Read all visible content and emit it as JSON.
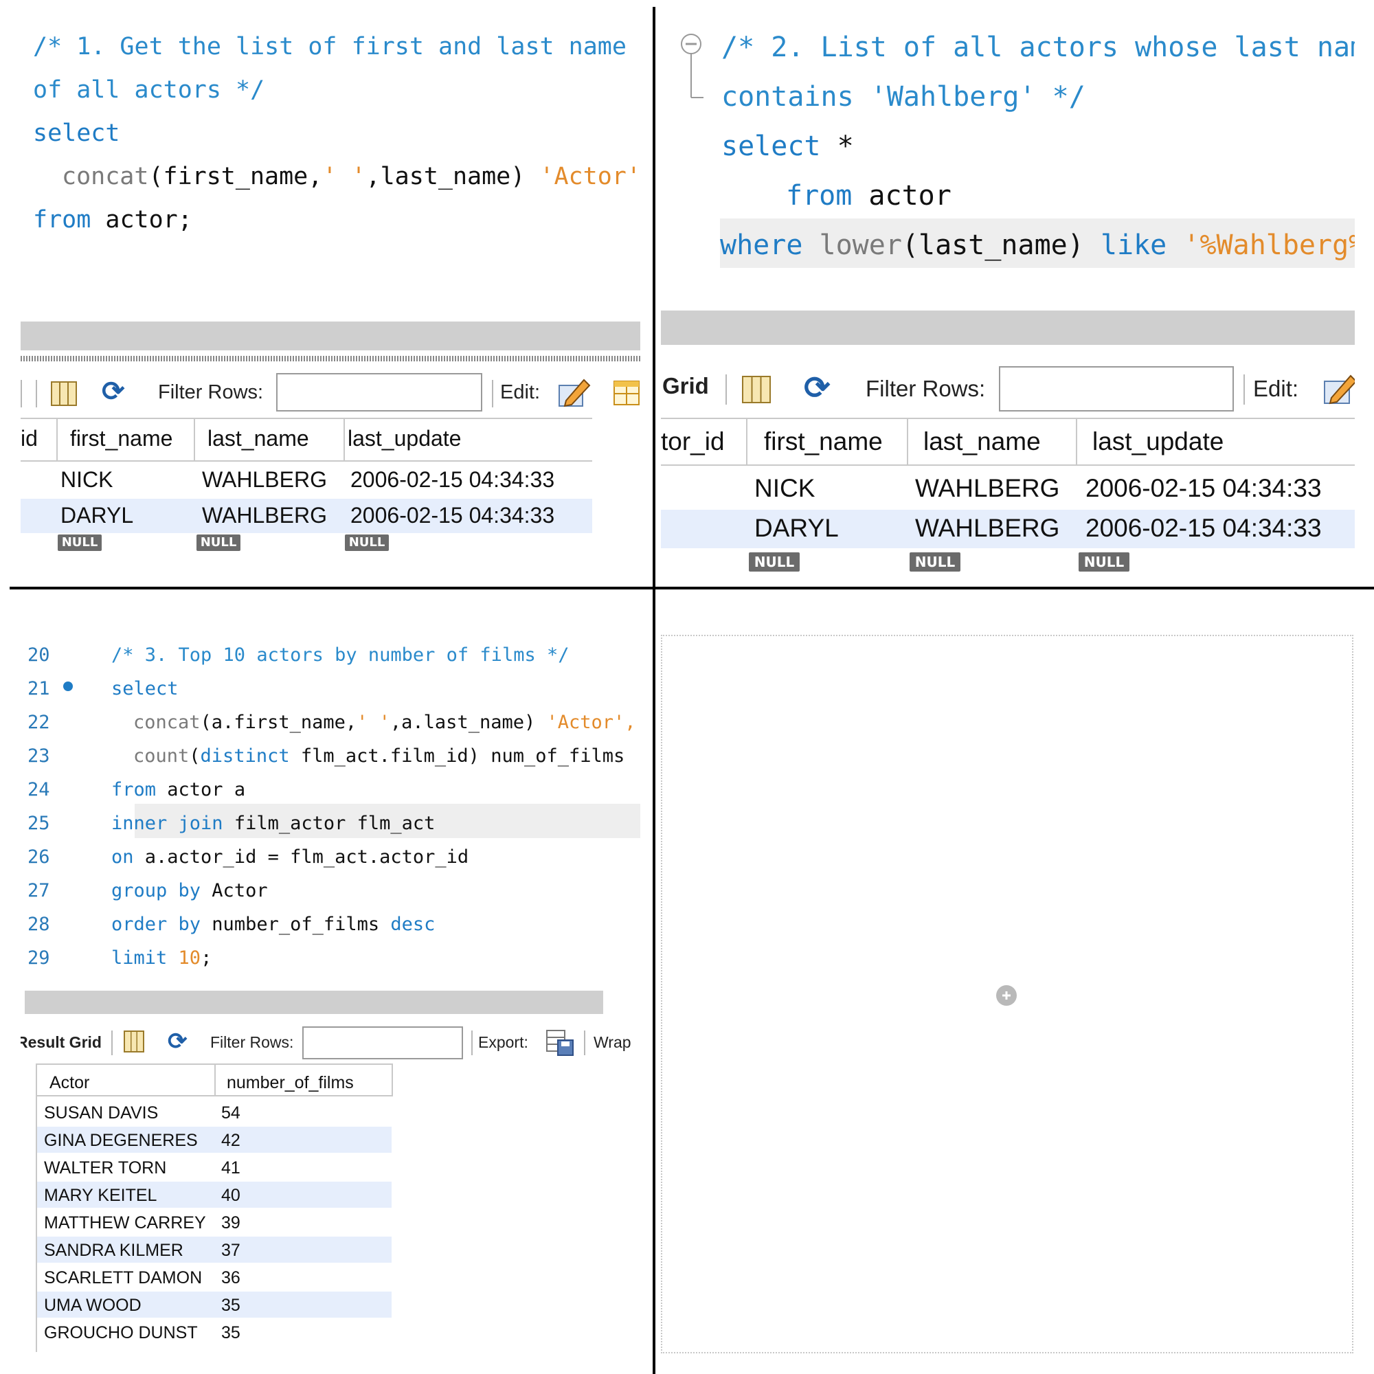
{
  "q1": {
    "code": {
      "comment_line1": "/* 1. Get the list of first and last name",
      "comment_line2": "of all actors */",
      "select": "select",
      "concat_fn": "concat",
      "concat_args": "(first_name,",
      "concat_str": "' '",
      "concat_args2": ",last_name)",
      "alias": "'Actor'",
      "from": "from",
      "table": " actor;"
    },
    "toolbar": {
      "filter_label": "Filter Rows:",
      "edit_label": "Edit:"
    },
    "table": {
      "columns": [
        "id",
        "first_name",
        "last_name",
        "last_update"
      ],
      "rows": [
        [
          "NICK",
          "WAHLBERG",
          "2006-02-15 04:34:33"
        ],
        [
          "DARYL",
          "WAHLBERG",
          "2006-02-15 04:34:33"
        ]
      ],
      "null_label": "NULL"
    }
  },
  "q2": {
    "code": {
      "comment_line1": "/* 2. List of all actors whose last nam",
      "comment_line2": "contains 'Wahlberg' */",
      "select": "select",
      "star": " *",
      "from": "from",
      "table": " actor",
      "where": "where",
      "lower_fn": "lower",
      "lower_args": "(last_name)",
      "like": "like",
      "pattern": "'%Wahlberg%"
    },
    "toolbar": {
      "grid_label": "Grid",
      "filter_label": "Filter Rows:",
      "edit_label": "Edit:"
    },
    "table": {
      "columns": [
        "tor_id",
        "first_name",
        "last_name",
        "last_update"
      ],
      "rows": [
        [
          "NICK",
          "WAHLBERG",
          "2006-02-15 04:34:33"
        ],
        [
          "DARYL",
          "WAHLBERG",
          "2006-02-15 04:34:33"
        ]
      ],
      "null_label": "NULL"
    }
  },
  "q3": {
    "code": {
      "line_numbers": [
        "20",
        "21",
        "22",
        "23",
        "24",
        "25",
        "26",
        "27",
        "28",
        "29"
      ],
      "comment": "/* 3. Top 10 actors by number of films */",
      "select": "select",
      "concat_fn": "concat",
      "concat_args": "(a.first_name,",
      "concat_str": "' '",
      "concat_args2": ",a.last_name)",
      "alias": "'Actor',",
      "count_fn": "count",
      "count_open": "(",
      "distinct": "distinct",
      "count_rest": " flm_act.film_id) num_of_films",
      "from": "from",
      "from_rest": " actor a",
      "inner_join": "inner join",
      "join_rest": " film_actor flm_act",
      "on": "on",
      "on_rest": " a.actor_id = flm_act.actor_id",
      "group_by": "group by",
      "group_rest": " Actor",
      "order_by": "order by",
      "order_rest": " number_of_films ",
      "desc": "desc",
      "limit": "limit",
      "limit_val": "10",
      "semicolon": ";"
    },
    "toolbar": {
      "result_grid": "Result Grid",
      "filter_label": "Filter Rows:",
      "export_label": "Export:",
      "wrap_label": "Wrap"
    },
    "table": {
      "columns": [
        "Actor",
        "number_of_films"
      ],
      "rows": [
        [
          "SUSAN DAVIS",
          "54"
        ],
        [
          "GINA DEGENERES",
          "42"
        ],
        [
          "WALTER TORN",
          "41"
        ],
        [
          "MARY KEITEL",
          "40"
        ],
        [
          "MATTHEW CARREY",
          "39"
        ],
        [
          "SANDRA KILMER",
          "37"
        ],
        [
          "SCARLETT DAMON",
          "36"
        ],
        [
          "UMA WOOD",
          "35"
        ],
        [
          "GROUCHO DUNST",
          "35"
        ]
      ]
    }
  },
  "q4": {
    "add_icon": "plus-icon"
  },
  "colors": {
    "keyword": "#1f7cc5",
    "string": "#e38b2b",
    "alt_row": "#e6eefc",
    "null_badge": "#6b6b6b"
  }
}
